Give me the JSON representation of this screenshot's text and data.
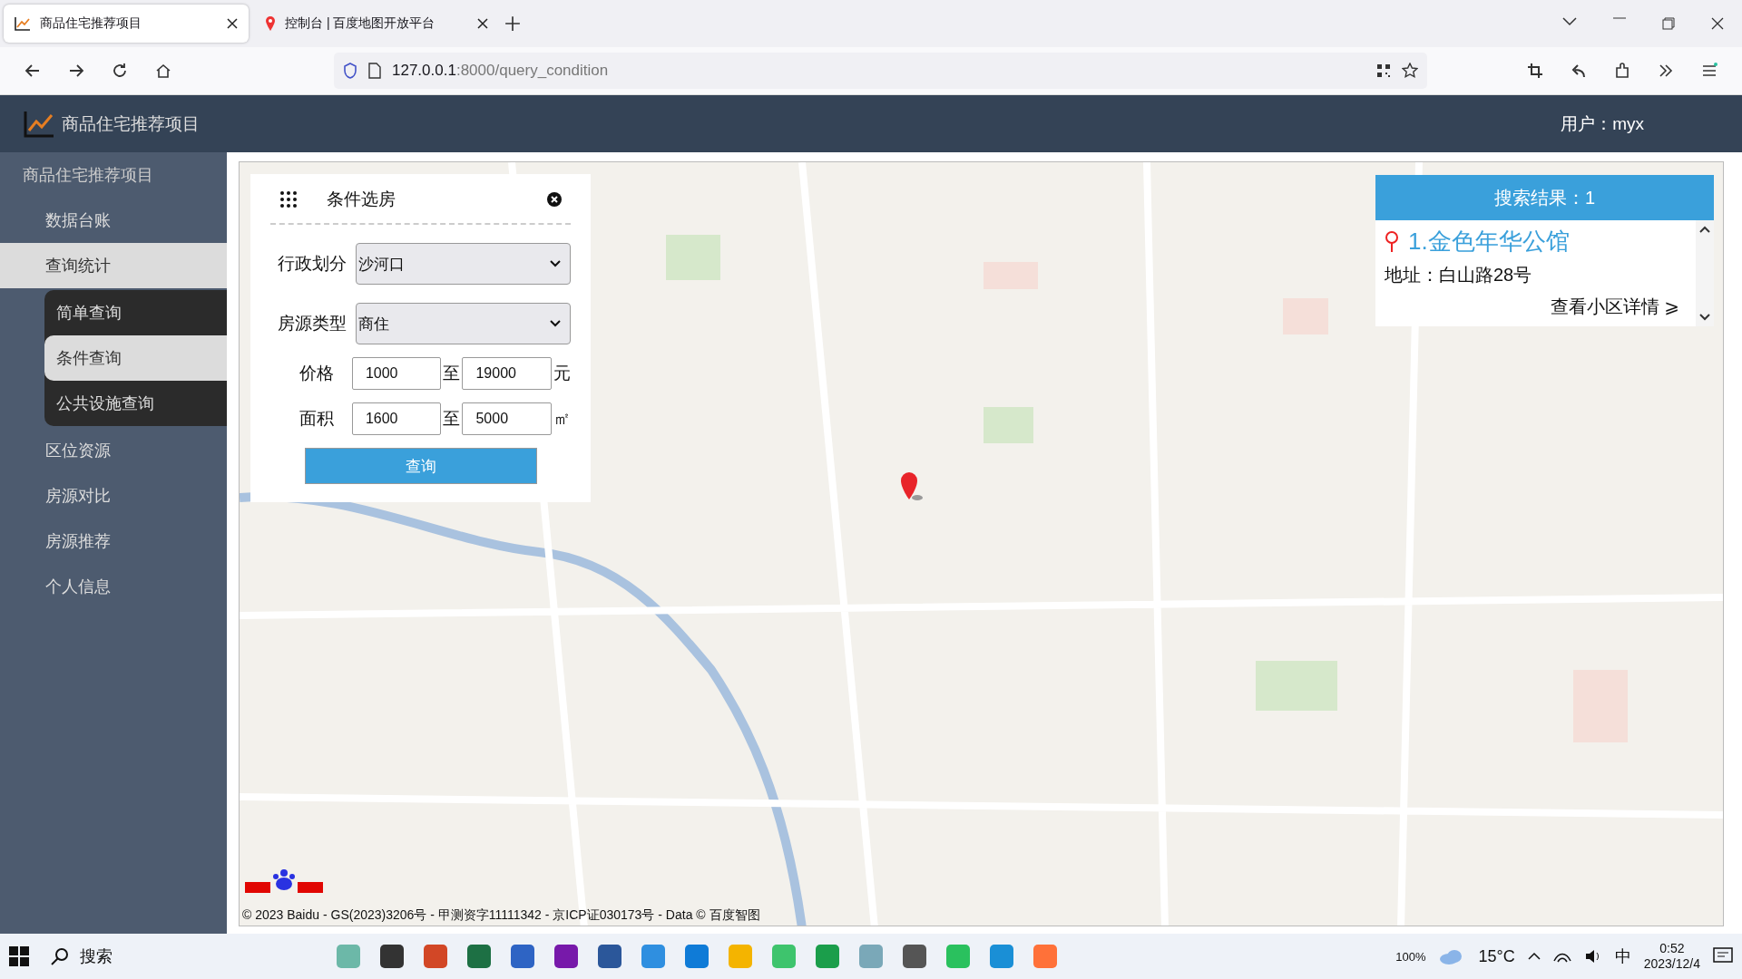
{
  "browser": {
    "tabs": [
      {
        "title": "商品住宅推荐项目",
        "selected": true
      },
      {
        "title": "控制台 | 百度地图开放平台",
        "selected": false
      }
    ],
    "url_host": "127.0.0.1",
    "url_path": ":8000/query_condition"
  },
  "header": {
    "title": "商品住宅推荐项目",
    "user": "用户：myx"
  },
  "sidebar": {
    "title": "商品住宅推荐项目",
    "items": [
      {
        "label": "数据台账",
        "selected": false
      },
      {
        "label": "查询统计",
        "selected": true,
        "children": [
          {
            "label": "简单查询",
            "selected": false
          },
          {
            "label": "条件查询",
            "selected": true
          },
          {
            "label": "公共设施查询",
            "selected": false
          }
        ]
      },
      {
        "label": "区位资源",
        "selected": false
      },
      {
        "label": "房源对比",
        "selected": false
      },
      {
        "label": "房源推荐",
        "selected": false
      },
      {
        "label": "个人信息",
        "selected": false
      }
    ]
  },
  "query_panel": {
    "title": "条件选房",
    "fields": [
      {
        "kind": "select",
        "label": "行政划分",
        "value": "沙河口"
      },
      {
        "kind": "select",
        "label": "房源类型",
        "value": "商住"
      },
      {
        "kind": "range",
        "label": "价格",
        "from": "1000",
        "sep": "至",
        "to": "19000",
        "unit": "元"
      },
      {
        "kind": "range",
        "label": "面积",
        "from": "1600",
        "sep": "至",
        "to": "5000",
        "unit": "㎡"
      }
    ],
    "button": "查询"
  },
  "results": {
    "header": "搜索结果：1",
    "items": [
      {
        "name": "1.金色年华公馆",
        "address": "地址：白山路28号",
        "link": "查看小区详情 ⩾"
      }
    ]
  },
  "map": {
    "copyright": "© 2023 Baidu - GS(2023)3206号 - 甲测资字11111342 - 京ICP证030173号 - Data © 百度智图"
  },
  "taskbar": {
    "search": "搜索",
    "battery": "100%",
    "weather": "15°C",
    "ime": "中",
    "time": "0:52",
    "date": "2023/12/4"
  }
}
